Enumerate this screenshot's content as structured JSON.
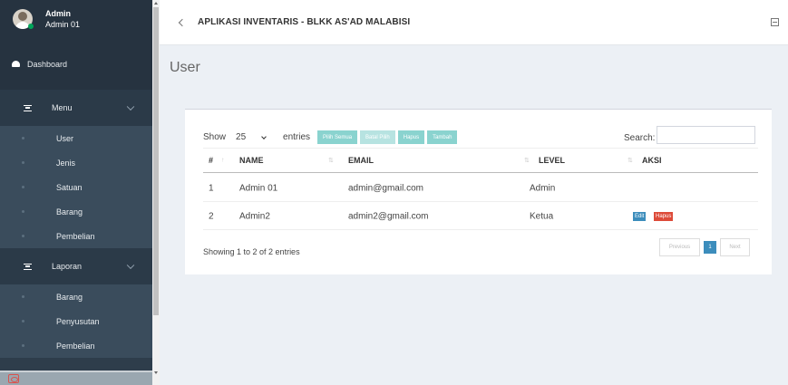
{
  "user": {
    "name": "Admin",
    "role": "Admin 01"
  },
  "sidebar": {
    "dashboard": "Dashboard",
    "groups": [
      {
        "label": "Menu",
        "items": [
          "User",
          "Jenis",
          "Satuan",
          "Barang",
          "Pembelian"
        ]
      },
      {
        "label": "Laporan",
        "items": [
          "Barang",
          "Penyusutan",
          "Pembelian"
        ]
      }
    ]
  },
  "topbar": {
    "title": "APLIKASI INVENTARIS - BLKK AS'AD MALABISI"
  },
  "page": {
    "title": "User"
  },
  "table_controls": {
    "show_label": "Show",
    "page_size": "25",
    "entries_label": "entries",
    "buttons": [
      "Pilih Semua",
      "Batal Pilih",
      "Hapus",
      "Tambah"
    ],
    "search_label": "Search:",
    "search_value": ""
  },
  "table": {
    "headers": [
      "#",
      "NAME",
      "EMAIL",
      "LEVEL",
      "AKSI"
    ],
    "rows": [
      {
        "no": "1",
        "name": "Admin 01",
        "email": "admin@gmail.com",
        "level": "Admin",
        "actions": []
      },
      {
        "no": "2",
        "name": "Admin2",
        "email": "admin2@gmail.com",
        "level": "Ketua",
        "actions": [
          "Edit",
          "Hapus"
        ]
      }
    ]
  },
  "footer": {
    "info": "Showing 1 to 2 of 2 entries",
    "pager": {
      "prev": "Previous",
      "current": "1",
      "next": "Next"
    }
  },
  "colors": {
    "sidebar_bg": "#2e3d4b",
    "accent_teal": "#8ad3cf",
    "primary_blue": "#3c8dbc",
    "danger_red": "#dd4b39"
  }
}
